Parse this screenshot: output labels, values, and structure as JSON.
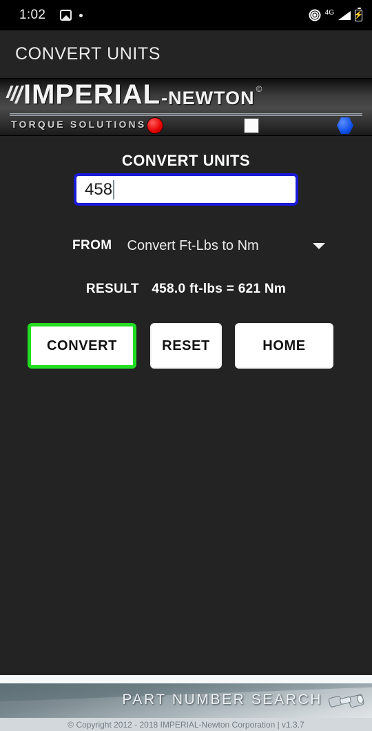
{
  "statusbar": {
    "time": "1:02",
    "photo_icon": "image-icon",
    "dot_icon": "dot-icon",
    "cast_icon": "hotspot-icon",
    "network": "4G",
    "signal_icon": "signal-bars-icon",
    "battery_icon": "battery-charging-icon",
    "battery_glyph": "⚡"
  },
  "appbar": {
    "title": "CONVERT UNITS"
  },
  "banner": {
    "logo_main": "IMPERIAL",
    "logo_sub": "-NEWTON",
    "registered": "©",
    "tagline": "TORQUE SOLUTIONS",
    "shapes": {
      "red": "red-circle-indicator",
      "white": "white-square-indicator",
      "blue": "blue-hexagon-indicator"
    },
    "colors": {
      "red": "#e60000",
      "white": "#fbfbfb",
      "blue": "#1050e8"
    }
  },
  "form": {
    "heading": "CONVERT UNITS",
    "input": {
      "value": "458",
      "placeholder": "",
      "border_color": "#1a1ad8"
    },
    "from": {
      "label": "FROM",
      "selected": "Convert Ft-Lbs to Nm",
      "caret_icon": "chevron-down-icon"
    },
    "result": {
      "label": "RESULT",
      "value": "458.0 ft-lbs = 621 Nm"
    },
    "buttons": {
      "convert": "CONVERT",
      "reset": "RESET",
      "home": "HOME",
      "focus_color": "#22dd22"
    }
  },
  "footer": {
    "part_number_search": "PART NUMBER SEARCH",
    "binoculars_icon": "binoculars-icon",
    "copyright": "© Copyright 2012 - 2018 IMPERIAL-Newton Corporation | v1.3.7"
  }
}
